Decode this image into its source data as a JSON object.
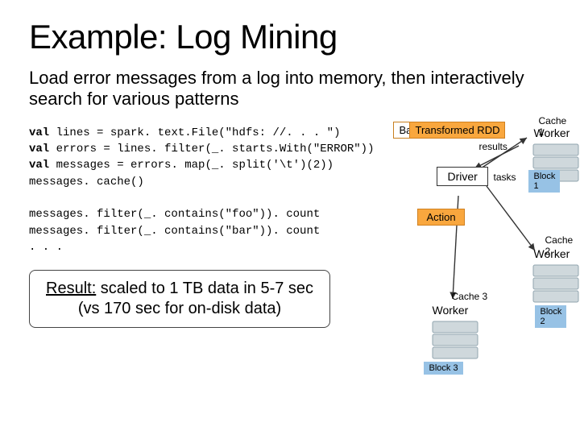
{
  "slide": {
    "title": "Example: Log Mining",
    "subtitle": "Load error messages from a log into memory, then interactively search for various patterns"
  },
  "code": {
    "l1a": "val",
    "l1b": " lines = spark. text.File(\"hdfs: //. . . \")",
    "l2a": "val",
    "l2b": " errors = lines. filter(_. starts.With(\"ERROR\"))",
    "l3a": "val",
    "l3b": " messages = errors. map(_. split('\\t')(2))",
    "l4": "messages. cache()",
    "blank1": "",
    "l5": "messages. filter(_. contains(\"foo\")). count",
    "l6": "messages. filter(_. contains(\"bar\")). count",
    "l7": ". . ."
  },
  "result": {
    "label": "Result:",
    "line1_rest": " scaled to 1 TB data in 5-7 sec",
    "line2": "(vs 170 sec for on-disk data)"
  },
  "diagram": {
    "ba_rdd": "Ba",
    "transformed_rdd": "Transformed RDD",
    "action": "Action",
    "driver": "Driver",
    "results": "results",
    "tasks": "tasks",
    "worker": "Worker",
    "cache1": "Cache 1",
    "cache2": "Cache 2",
    "cache3": "Cache 3",
    "block1": "Block 1",
    "block2": "Block 2",
    "block3": "Block 3"
  }
}
